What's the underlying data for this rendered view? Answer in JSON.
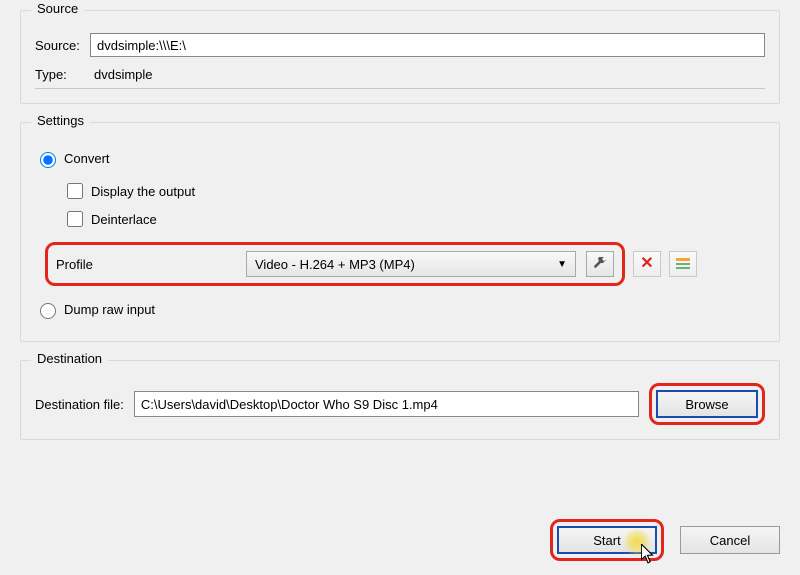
{
  "source": {
    "group_title": "Source",
    "source_label": "Source:",
    "source_value": "dvdsimple:\\\\\\E:\\",
    "type_label": "Type:",
    "type_value": "dvdsimple"
  },
  "settings": {
    "group_title": "Settings",
    "convert_label": "Convert",
    "convert_selected": true,
    "checkboxes": {
      "display_output_label": "Display the output",
      "display_output_checked": false,
      "deinterlace_label": "Deinterlace",
      "deinterlace_checked": false
    },
    "profile": {
      "label": "Profile",
      "selected": "Video - H.264 + MP3 (MP4)",
      "icons": {
        "wrench": "wrench-icon",
        "delete": "close-x-icon",
        "new": "list-new-icon"
      }
    },
    "dump_label": "Dump raw input",
    "dump_selected": false
  },
  "destination": {
    "group_title": "Destination",
    "file_label": "Destination file:",
    "file_value": "C:\\Users\\david\\Desktop\\Doctor Who S9 Disc 1.mp4",
    "browse_label": "Browse"
  },
  "buttons": {
    "start": "Start",
    "cancel": "Cancel"
  }
}
